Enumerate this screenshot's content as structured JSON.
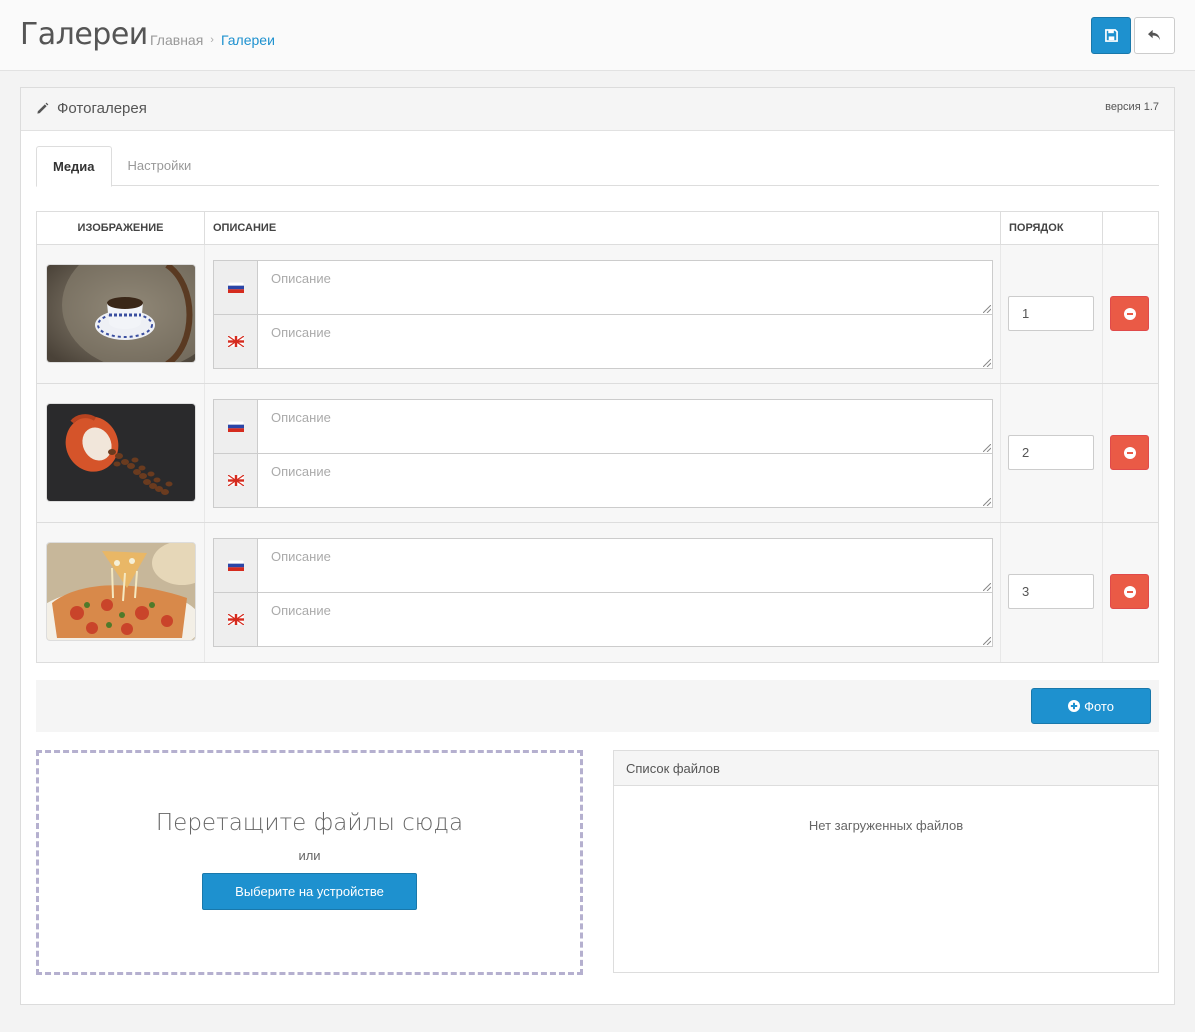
{
  "header": {
    "title": "Галереи",
    "breadcrumb": [
      "Главная",
      "Галереи"
    ],
    "save_icon": "save-icon",
    "back_icon": "reply-icon"
  },
  "panel": {
    "title": "Фотогалерея",
    "version": "версия 1.7",
    "title_icon": "pencil-icon"
  },
  "tabs": [
    {
      "label": "Медиа",
      "active": true
    },
    {
      "label": "Настройки",
      "active": false
    }
  ],
  "table": {
    "columns": [
      "Изображение",
      "Описание",
      "Порядок",
      ""
    ],
    "rows": [
      {
        "image": "coffee-cup-on-table",
        "desc_ru_placeholder": "Описание",
        "desc_en_placeholder": "Описание",
        "order": "1"
      },
      {
        "image": "coffee-beans-spill",
        "desc_ru_placeholder": "Описание",
        "desc_en_placeholder": "Описание",
        "order": "2"
      },
      {
        "image": "pizza-slice",
        "desc_ru_placeholder": "Описание",
        "desc_en_placeholder": "Описание",
        "order": "3"
      }
    ]
  },
  "add_photo_label": "Фото",
  "dropzone": {
    "title": "Перетащите файлы сюда",
    "or": "или",
    "choose_label": "Выберите на устройстве"
  },
  "filelist": {
    "title": "Список файлов",
    "empty": "Нет загруженных файлов"
  },
  "colors": {
    "primary": "#1e91cf",
    "danger": "#ea5a46",
    "dropzone_border": "#b5b0cf"
  }
}
